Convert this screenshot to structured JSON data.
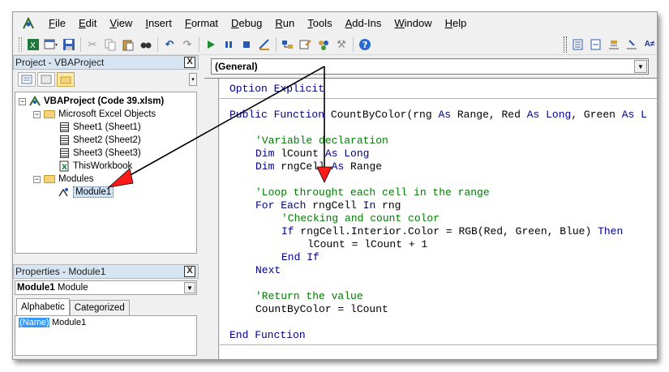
{
  "menu": {
    "items": [
      "File",
      "Edit",
      "View",
      "Insert",
      "Format",
      "Debug",
      "Run",
      "Tools",
      "Add-Ins",
      "Window",
      "Help"
    ]
  },
  "toolbar": {
    "icons": [
      "excel-view-icon",
      "insert-userform-icon",
      "save-icon",
      "cut-icon",
      "copy-icon",
      "paste-icon",
      "find-icon",
      "undo-icon",
      "redo-icon",
      "run-icon",
      "break-icon",
      "reset-icon",
      "design-mode-icon",
      "project-explorer-icon",
      "properties-window-icon",
      "object-browser-icon",
      "toolbox-icon",
      "help-icon"
    ]
  },
  "project_pane": {
    "title": "Project - VBAProject",
    "close": "X",
    "tree": {
      "project": "VBAProject (Code 39.xlsm)",
      "objects_folder": "Microsoft Excel Objects",
      "sheets": [
        "Sheet1 (Sheet1)",
        "Sheet2 (Sheet2)",
        "Sheet3 (Sheet3)"
      ],
      "workbook": "ThisWorkbook",
      "modules_folder": "Modules",
      "module": "Module1"
    }
  },
  "properties_pane": {
    "title": "Properties - Module1",
    "close": "X",
    "object_bold": "Module1",
    "object_type": "Module",
    "tabs": [
      "Alphabetic",
      "Categorized"
    ],
    "row_key": "(Name)",
    "row_value": "Module1"
  },
  "code_window": {
    "object_combo": "(General)",
    "lines": {
      "l1": "Option Explicit",
      "l2_kw": "Public Function",
      "l2_rest": " CountByColor(rng ",
      "l2_as1": "As",
      "l2_range": " Range, Red ",
      "l2_as2": "As Long",
      "l2_green": ", Green ",
      "l2_as3": "As L",
      "l3": "'Variable declaration",
      "l4_kw1": "Dim",
      "l4_mid": " lCount ",
      "l4_kw2": "As Long",
      "l5_kw1": "Dim",
      "l5_mid": " rngCell ",
      "l5_kw2": "As",
      "l5_end": " Range",
      "l6": "'Loop throught each cell in the range",
      "l7_kw1": "For Each",
      "l7_mid": " rngCell ",
      "l7_kw2": "In",
      "l7_end": " rng",
      "l8": "'Checking and count color",
      "l9_kw1": "If",
      "l9_mid": " rngCell.Interior.Color = RGB(Red, Green, Blue) ",
      "l9_kw2": "Then",
      "l10": "lCount = lCount + 1",
      "l11": "End If",
      "l12": "Next",
      "l13": "'Return the value",
      "l14": "CountByColor = lCount",
      "l15": "End Function"
    }
  },
  "colors": {
    "keyword": "#00008b",
    "comment": "#007a00",
    "arrow_head": "#ff0000"
  }
}
